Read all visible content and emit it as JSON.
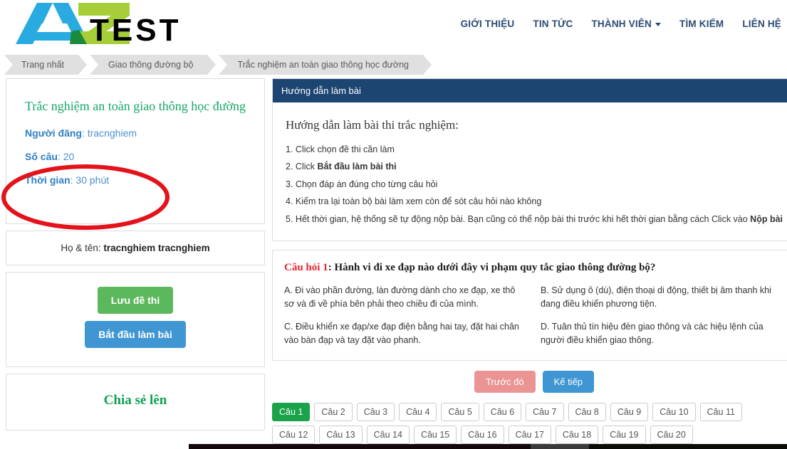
{
  "brand": {
    "logo_text_a": "A",
    "logo_text_z": "Z",
    "logo_text_test": "TEST",
    "colors": {
      "blue": "#29abe2",
      "green": "#a6ce39",
      "dark_green": "#1a8a3c",
      "black": "#000000"
    }
  },
  "nav": {
    "items": [
      {
        "label": "GIỚI THIỆU",
        "has_dropdown": false
      },
      {
        "label": "TIN TỨC",
        "has_dropdown": false
      },
      {
        "label": "THÀNH VIÊN",
        "has_dropdown": true
      },
      {
        "label": "TÌM KIẾM",
        "has_dropdown": false
      },
      {
        "label": "LIÊN HỆ",
        "has_dropdown": false
      }
    ]
  },
  "breadcrumb": {
    "items": [
      {
        "label": "Trang nhất"
      },
      {
        "label": "Giao thông đường bộ"
      },
      {
        "label": "Trắc nghiệm an toàn giao thông học đường"
      }
    ]
  },
  "sidebar": {
    "exam_title": "Trắc nghiệm an toàn giao thông học đường",
    "info": [
      {
        "label": "Người đăng",
        "value": "tracnghiem"
      },
      {
        "label": "Số câu",
        "value": "20"
      },
      {
        "label": "Thời gian",
        "value": "30 phút"
      }
    ],
    "user": {
      "label": "Họ & tên:",
      "value": "tracnghiem tracnghiem"
    },
    "buttons": {
      "save_label": "Lưu đề thi",
      "start_label": "Bắt đầu làm bài"
    },
    "share_title": "Chia sẻ lên"
  },
  "guide": {
    "panel_header": "Hướng dẫn làm bài",
    "title": "Hướng dẫn làm bài thi trắc nghiệm:",
    "steps": [
      {
        "num": "1.",
        "text": "Click chọn đề thi cần làm",
        "bold": "",
        "tail": ""
      },
      {
        "num": "2.",
        "text": "Click ",
        "bold": "Bắt đầu làm bài thi",
        "tail": ""
      },
      {
        "num": "3.",
        "text": "Chọn đáp án đúng cho từng câu hỏi",
        "bold": "",
        "tail": ""
      },
      {
        "num": "4.",
        "text": "Kiểm tra lại toàn bộ bài làm xem còn để sót câu hỏi nào không",
        "bold": "",
        "tail": ""
      },
      {
        "num": "5.",
        "text": "Hết thời gian, hệ thống sẽ tự động nộp bài. Bạn cũng có thể nộp bài thi trước khi hết thời gian bằng cách Click vào ",
        "bold": "Nộp bài",
        "tail": ""
      }
    ]
  },
  "question": {
    "number_label": "Câu hỏi 1",
    "separator": ": ",
    "text": "Hành vi đi xe đạp nào dưới đây vi phạm quy tắc giao thông đường bộ?",
    "answers": [
      {
        "key": "A.",
        "text": "Đi vào phần đường, làn đường dành cho xe đạp, xe thô sơ và đi về phía bên phải theo chiều đi của mình."
      },
      {
        "key": "B.",
        "text": "Sử dụng ô (dù), điện thoại di động, thiết bị âm thanh khi đang điều khiển phương tiện."
      },
      {
        "key": "C.",
        "text": "Điều khiển xe đạp/xe đạp điện bằng hai tay, đặt hai chân vào bàn đạp và tay đặt vào phanh."
      },
      {
        "key": "D.",
        "text": "Tuân thủ tín hiệu đèn giao thông và các hiệu lệnh của người điều khiển giao thông."
      }
    ]
  },
  "navigation": {
    "prev_label": "Trước đó",
    "next_label": "Kế tiếp",
    "prev_disabled": true
  },
  "pager": {
    "active_index": 0,
    "items": [
      {
        "label": "Câu 1"
      },
      {
        "label": "Câu 2"
      },
      {
        "label": "Câu 3"
      },
      {
        "label": "Câu 4"
      },
      {
        "label": "Câu 5"
      },
      {
        "label": "Câu 6"
      },
      {
        "label": "Câu 7"
      },
      {
        "label": "Câu 8"
      },
      {
        "label": "Câu 9"
      },
      {
        "label": "Câu 10"
      },
      {
        "label": "Câu 11"
      },
      {
        "label": "Câu 12"
      },
      {
        "label": "Câu 13"
      },
      {
        "label": "Câu 14"
      },
      {
        "label": "Câu 15"
      },
      {
        "label": "Câu 16"
      },
      {
        "label": "Câu 17"
      },
      {
        "label": "Câu 18"
      },
      {
        "label": "Câu 19"
      },
      {
        "label": "Câu 20"
      }
    ]
  },
  "annotation": {
    "shape": "ellipse",
    "color": "#e4121a",
    "covers": [
      "Số câu: 20",
      "Thời gian: 30 phút"
    ]
  }
}
